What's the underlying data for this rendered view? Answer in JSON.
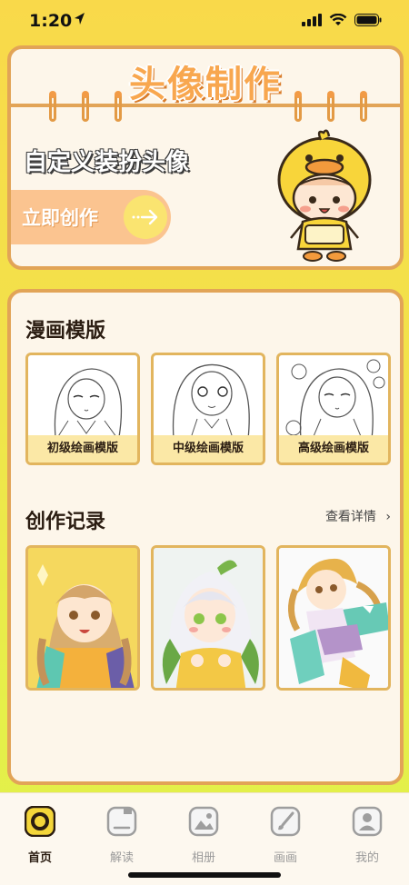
{
  "status_bar": {
    "time": "1:20"
  },
  "hero": {
    "title": "头像制作",
    "subtitle": "自定义装扮头像",
    "create_button": "立即创作"
  },
  "templates_section": {
    "title": "漫画模版",
    "items": [
      {
        "label": "初级绘画模版"
      },
      {
        "label": "中级绘画模版"
      },
      {
        "label": "高级绘画模版"
      }
    ]
  },
  "records_section": {
    "title": "创作记录",
    "see_more": "查看详情",
    "items": [
      {
        "icon": "anime-girl-yellow-jacket"
      },
      {
        "icon": "anime-girl-white-hair"
      },
      {
        "icon": "anime-girl-dancing"
      }
    ]
  },
  "tabbar": {
    "items": [
      {
        "label": "首页",
        "icon": "home-icon",
        "active": true
      },
      {
        "label": "解读",
        "icon": "interpret-icon",
        "active": false
      },
      {
        "label": "相册",
        "icon": "album-icon",
        "active": false
      },
      {
        "label": "画画",
        "icon": "brush-icon",
        "active": false
      },
      {
        "label": "我的",
        "icon": "profile-icon",
        "active": false
      }
    ]
  },
  "colors": {
    "accent_orange": "#e2a457",
    "title_orange": "#f8a74f",
    "panel_bg": "#fdf6ea",
    "highlight_yellow": "#f6d73b"
  }
}
